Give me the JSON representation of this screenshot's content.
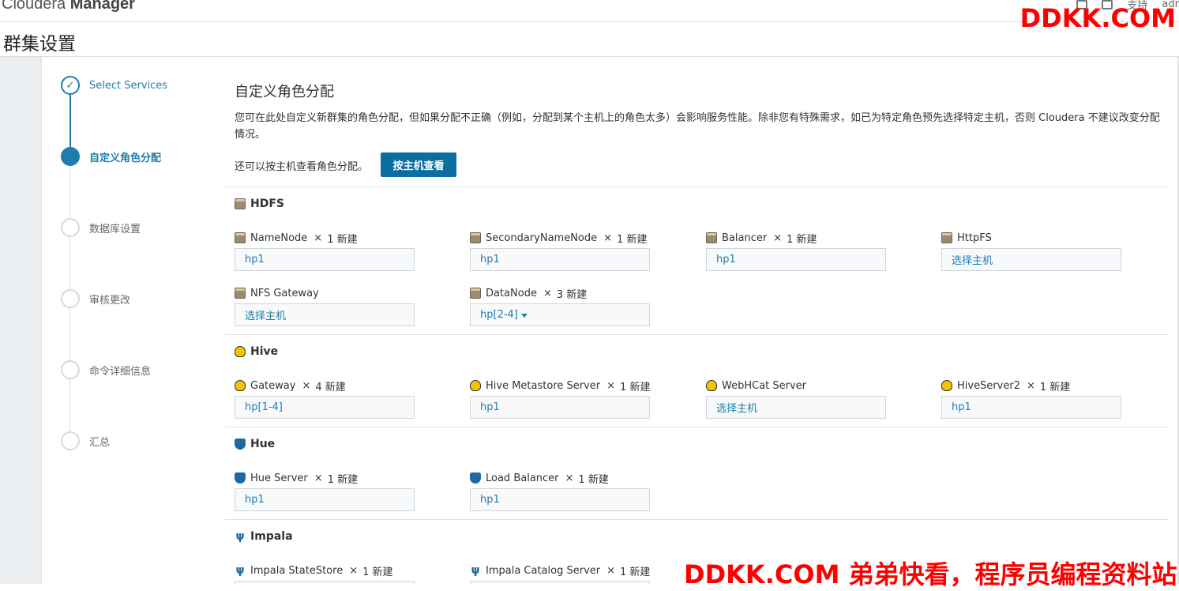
{
  "app": {
    "brand_light": "Cloudera ",
    "brand_bold": "Manager"
  },
  "topnav": {
    "support": "支持",
    "user": "adr"
  },
  "watermarks": {
    "top": "DDKK.COM",
    "bottom": "DDKK.COM 弟弟快看，程序员编程资料站"
  },
  "page": {
    "title": "群集设置"
  },
  "steps": [
    {
      "label": "Select Services",
      "state": "done"
    },
    {
      "label": "自定义角色分配",
      "state": "current"
    },
    {
      "label": "数据库设置",
      "state": "pending"
    },
    {
      "label": "审核更改",
      "state": "pending"
    },
    {
      "label": "命令详细信息",
      "state": "pending"
    },
    {
      "label": "汇总",
      "state": "pending"
    }
  ],
  "main": {
    "heading": "自定义角色分配",
    "description": "您可在此处自定义新群集的角色分配，但如果分配不正确（例如，分配到某个主机上的角色太多）会影响服务性能。除非您有特殊需求，如已为特定角色预先选择特定主机，否则 Cloudera 不建议改变分配情况。",
    "view_by_host_text": "还可以按主机查看角色分配。",
    "view_by_host_button": "按主机查看"
  },
  "services": {
    "hdfs": {
      "name": "HDFS",
      "roles": [
        {
          "name": "NameNode",
          "count": "1 新建",
          "value": "hp1"
        },
        {
          "name": "SecondaryNameNode",
          "count": "1 新建",
          "value": "hp1"
        },
        {
          "name": "Balancer",
          "count": "1 新建",
          "value": "hp1"
        },
        {
          "name": "HttpFS",
          "count": "",
          "value": "选择主机"
        },
        {
          "name": "NFS Gateway",
          "count": "",
          "value": "选择主机"
        },
        {
          "name": "DataNode",
          "count": "3 新建",
          "value": "hp[2-4]"
        }
      ]
    },
    "hive": {
      "name": "Hive",
      "roles": [
        {
          "name": "Gateway",
          "count": "4 新建",
          "value": "hp[1-4]"
        },
        {
          "name": "Hive Metastore Server",
          "count": "1 新建",
          "value": "hp1"
        },
        {
          "name": "WebHCat Server",
          "count": "",
          "value": "选择主机"
        },
        {
          "name": "HiveServer2",
          "count": "1 新建",
          "value": "hp1"
        }
      ]
    },
    "hue": {
      "name": "Hue",
      "roles": [
        {
          "name": "Hue Server",
          "count": "1 新建",
          "value": "hp1"
        },
        {
          "name": "Load Balancer",
          "count": "1 新建",
          "value": "hp1"
        }
      ]
    },
    "impala": {
      "name": "Impala",
      "roles": [
        {
          "name": "Impala StateStore",
          "count": "1 新建",
          "value": ""
        },
        {
          "name": "Impala Catalog Server",
          "count": "1 新建",
          "value": ""
        }
      ]
    }
  },
  "times_symbol": "×"
}
